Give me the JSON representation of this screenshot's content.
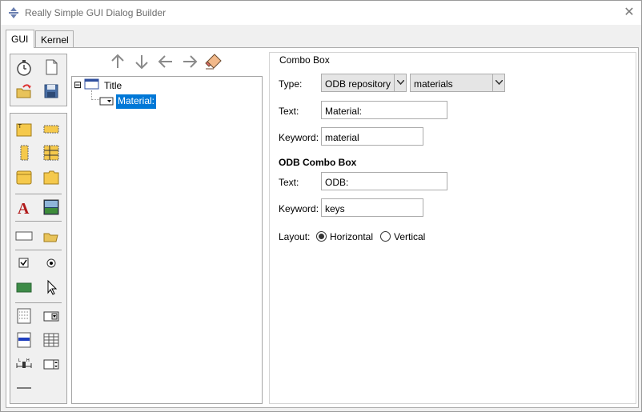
{
  "window": {
    "title": "Really Simple GUI Dialog Builder",
    "close_glyph": "✕"
  },
  "tabs": [
    {
      "label": "GUI",
      "active": true
    },
    {
      "label": "Kernel",
      "active": false
    }
  ],
  "tree": {
    "root": {
      "label": "Title",
      "expander": "⊟"
    },
    "child": {
      "label": "Material:",
      "selected": true
    }
  },
  "props": {
    "group_title": "Combo Box",
    "type_label": "Type:",
    "type_value": "ODB repository",
    "repo_value": "materials",
    "text_label": "Text:",
    "text_value": "Material:",
    "keyword_label": "Keyword:",
    "keyword_value": "material",
    "odb_heading": "ODB Combo Box",
    "odb_text_label": "Text:",
    "odb_text_value": "ODB:",
    "odb_keyword_label": "Keyword:",
    "odb_keyword_value": "keys",
    "layout_label": "Layout:",
    "layout_options": [
      {
        "label": "Horizontal",
        "selected": true
      },
      {
        "label": "Vertical",
        "selected": false
      }
    ]
  },
  "colors": {
    "selection": "#0078d7",
    "border": "#acacac"
  }
}
